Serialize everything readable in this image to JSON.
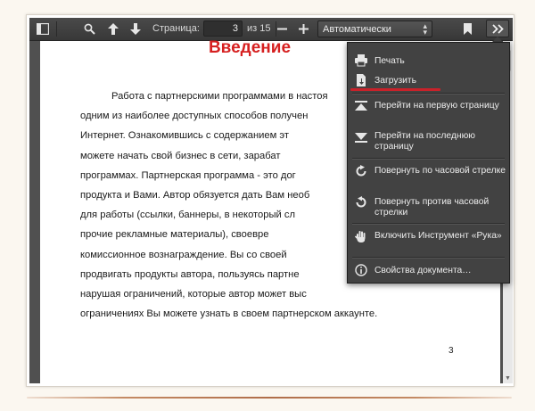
{
  "toolbar": {
    "page_label": "Страница:",
    "page_value": "3",
    "page_of": "из 15",
    "zoom_value": "Автоматически"
  },
  "document": {
    "title": "Введение",
    "lines": [
      "Работа с партнерскими программами в настоя",
      "одним из наиболее доступных способов получен",
      "Интернет. Ознакомившись с содержанием эт",
      "можете начать свой бизнес в сети, зарабат",
      "программах. Партнерская программа - это дог",
      "продукта и Вами. Автор обязуется дать Вам необ",
      "для работы (ссылки, баннеры, в некоторый сл",
      "прочие рекламные материалы), своевре",
      "комиссионное вознаграждение. Вы со своей",
      "продвигать продукты автора, пользуясь партне",
      "нарушая ограничений, которые автор может выс",
      "ограничениях Вы можете узнать в своем партнерском аккаунте."
    ],
    "page_number": "3"
  },
  "menu": {
    "print": "Печать",
    "download": "Загрузить",
    "first_page": "Перейти на первую страницу",
    "last_page": "Перейти на последнюю страницу",
    "rotate_cw": "Повернуть по часовой стрелке",
    "rotate_ccw": "Повернуть против часовой стрелки",
    "hand_tool": "Включить Инструмент «Рука»",
    "properties": "Свойства документа…"
  },
  "colors": {
    "title_red": "#d62020",
    "highlight_underline": "#c9222a",
    "toolbar_bg": "#404040"
  }
}
